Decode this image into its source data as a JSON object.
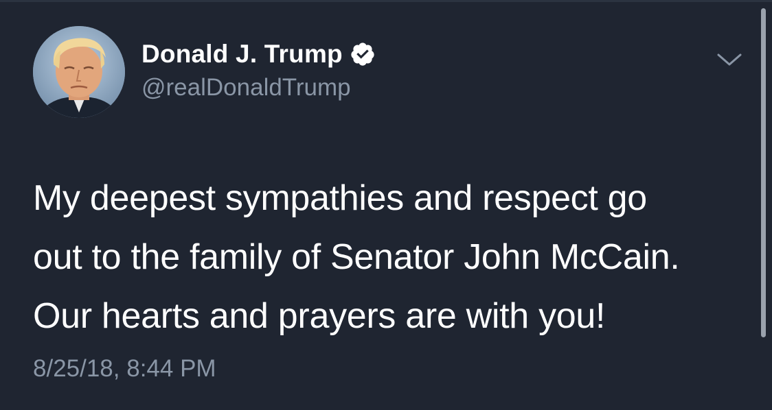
{
  "tweet": {
    "author": {
      "display_name": "Donald J. Trump",
      "handle": "@realDonaldTrump",
      "verified": true,
      "verified_icon": "verified-badge-icon",
      "avatar_icon": "profile-photo"
    },
    "text_lines": [
      "My deepest sympathies and respect go",
      "out to the family of Senator John McCain.",
      "Our hearts and prayers are with you!"
    ],
    "timestamp": "8/25/18, 8:44 PM",
    "menu_icon": "chevron-down-icon"
  },
  "colors": {
    "background": "#1f2531",
    "primary_text": "#ffffff",
    "secondary_text": "#8a96a6",
    "scrollbar": "#9aa2ad"
  }
}
